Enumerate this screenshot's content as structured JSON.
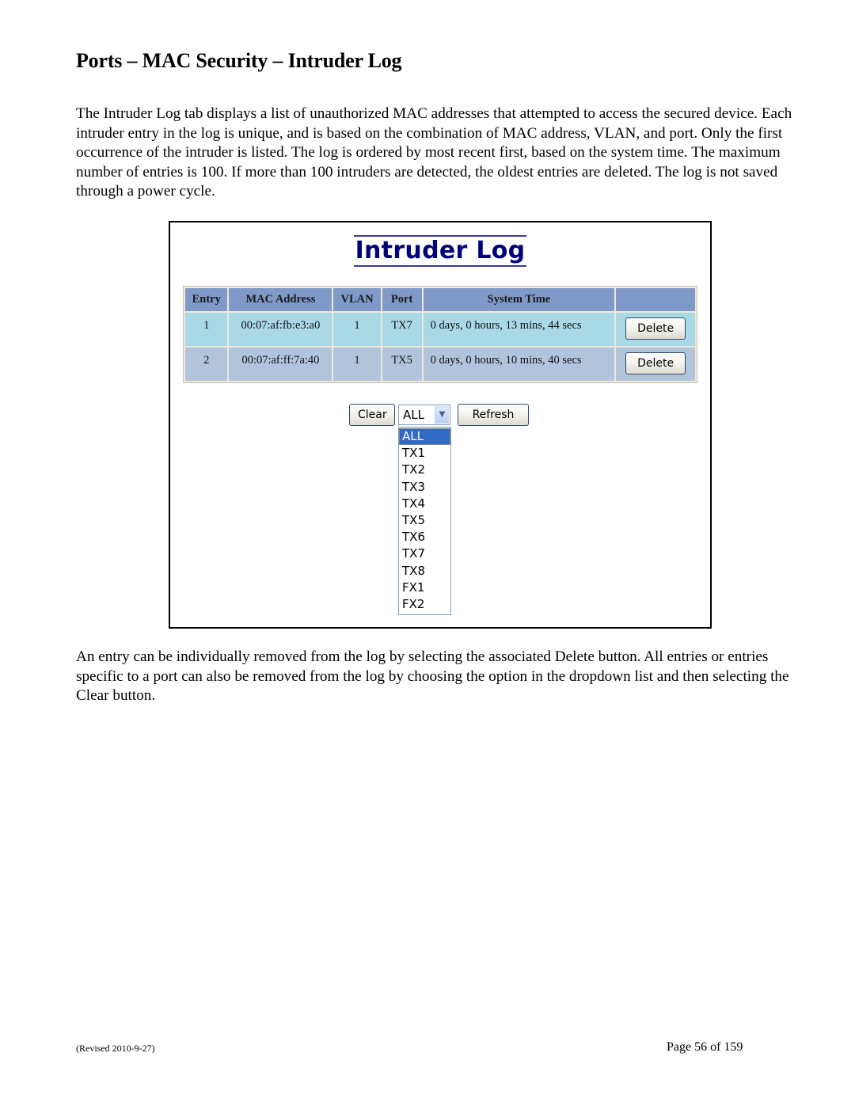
{
  "document": {
    "heading": "Ports – MAC Security – Intruder Log",
    "intro": "The Intruder Log tab displays a list of unauthorized MAC addresses that attempted to access the secured device.  Each intruder entry in the log is unique, and is based on the combination of MAC address, VLAN, and port.  Only the first occurrence of the intruder is listed.  The log is ordered by most recent first, based on the system time.  The maximum number of entries is 100.  If more than 100 intruders are detected, the oldest entries are deleted.  The log is not saved through a power cycle.",
    "outro": "An entry can be individually removed from the log by selecting the associated Delete button.  All entries or entries specific to a port can also be removed from the log by choosing the option in the dropdown list and then selecting the Clear button."
  },
  "ui": {
    "title": "Intruder Log",
    "table": {
      "headers": [
        "Entry",
        "MAC Address",
        "VLAN",
        "Port",
        "System Time",
        ""
      ],
      "rows": [
        {
          "entry": "1",
          "mac": "00:07:af:fb:e3:a0",
          "vlan": "1",
          "port": "TX7",
          "time": "0 days, 0 hours, 13 mins, 44 secs",
          "action": "Delete"
        },
        {
          "entry": "2",
          "mac": "00:07:af:ff:7a:40",
          "vlan": "1",
          "port": "TX5",
          "time": "0 days, 0 hours, 10 mins, 40 secs",
          "action": "Delete"
        }
      ]
    },
    "controls": {
      "clear_label": "Clear",
      "refresh_label": "Refresh",
      "port_select": {
        "selected": "ALL",
        "options": [
          "ALL",
          "TX1",
          "TX2",
          "TX3",
          "TX4",
          "TX5",
          "TX6",
          "TX7",
          "TX8",
          "FX1",
          "FX2"
        ],
        "arrow_icon": "chevron-down-icon"
      }
    },
    "colors": {
      "title": "#00007a",
      "header_bg": "#7f9ac8",
      "row_odd_bg": "#a9d8e6",
      "row_even_bg": "#b2c4dc",
      "selected_option_bg": "#316ac5"
    }
  },
  "footer": {
    "revised": "(Revised 2010-9-27)",
    "page": "Page 56 of 159"
  }
}
